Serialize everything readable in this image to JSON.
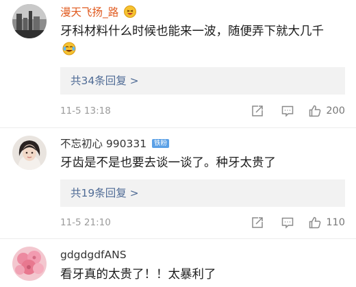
{
  "comments": [
    {
      "username": "漫天飞扬_路",
      "text": "牙科材料什么时候也能来一波，随便弄下就大几千",
      "replies_label": "共34条回复 >",
      "timestamp": "11-5 13:18",
      "likes": "200",
      "username_color": "#e05a1f"
    },
    {
      "username": "不忘初心 990331",
      "badge": "铁粉",
      "text": "牙齿是不是也要去谈一谈了。种牙太贵了",
      "replies_label": "共19条回复 >",
      "timestamp": "11-5 21:10",
      "likes": "110",
      "username_color": "#333333"
    },
    {
      "username": "gdgdgdfANS",
      "text": "看牙真的太贵了！！太暴利了",
      "username_color": "#333333"
    }
  ],
  "colors": {
    "accent_link": "#4f6b95",
    "reply_bg": "#f2f2f2",
    "meta_gray": "#9a9a9a",
    "badge": "#5aa0e6"
  },
  "icons": [
    "share-icon",
    "comment-icon",
    "like-icon",
    "lol-emoji-icon",
    "crying-laugh-emoji-icon"
  ]
}
